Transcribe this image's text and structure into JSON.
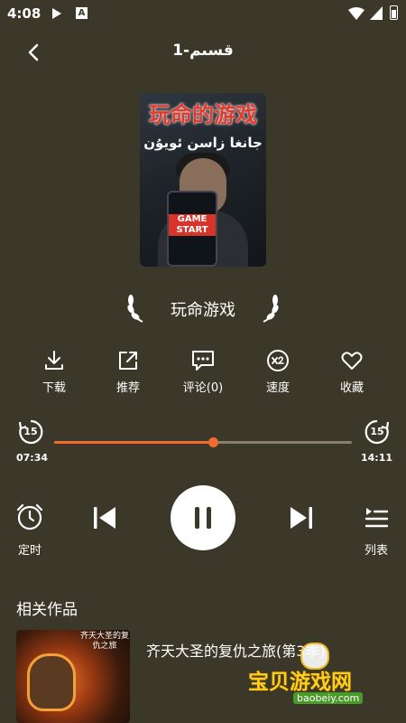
{
  "status_bar": {
    "time": "4:08",
    "a_badge": "A"
  },
  "header": {
    "title": "1-قسىم"
  },
  "cover": {
    "title": "玩命的游戏",
    "subtitle": "جانغا زاسن ئويۇن",
    "phone_text": "GAME START"
  },
  "work_name": "玩命游戏",
  "actions": [
    {
      "label": "下载",
      "icon": "download-icon"
    },
    {
      "label": "推荐",
      "icon": "share-icon"
    },
    {
      "label": "评论(0)",
      "icon": "comment-icon"
    },
    {
      "label": "速度",
      "icon": "speed-icon"
    },
    {
      "label": "收藏",
      "icon": "heart-icon"
    }
  ],
  "playback": {
    "current_time": "07:34",
    "total_time": "14:11",
    "progress": 0.534,
    "skip_back": "15",
    "skip_forward": "15",
    "accent_color": "#f26a2e"
  },
  "controls": {
    "timer_label": "定时",
    "list_label": "列表"
  },
  "related": {
    "heading": "相关作品",
    "items": [
      {
        "title": "齐天大圣的复仇之旅(第3季)",
        "thumb_text": "齐天大圣的复仇之旅"
      }
    ]
  },
  "watermark": {
    "text": "宝贝游戏网",
    "url": "baobeiy.com"
  }
}
